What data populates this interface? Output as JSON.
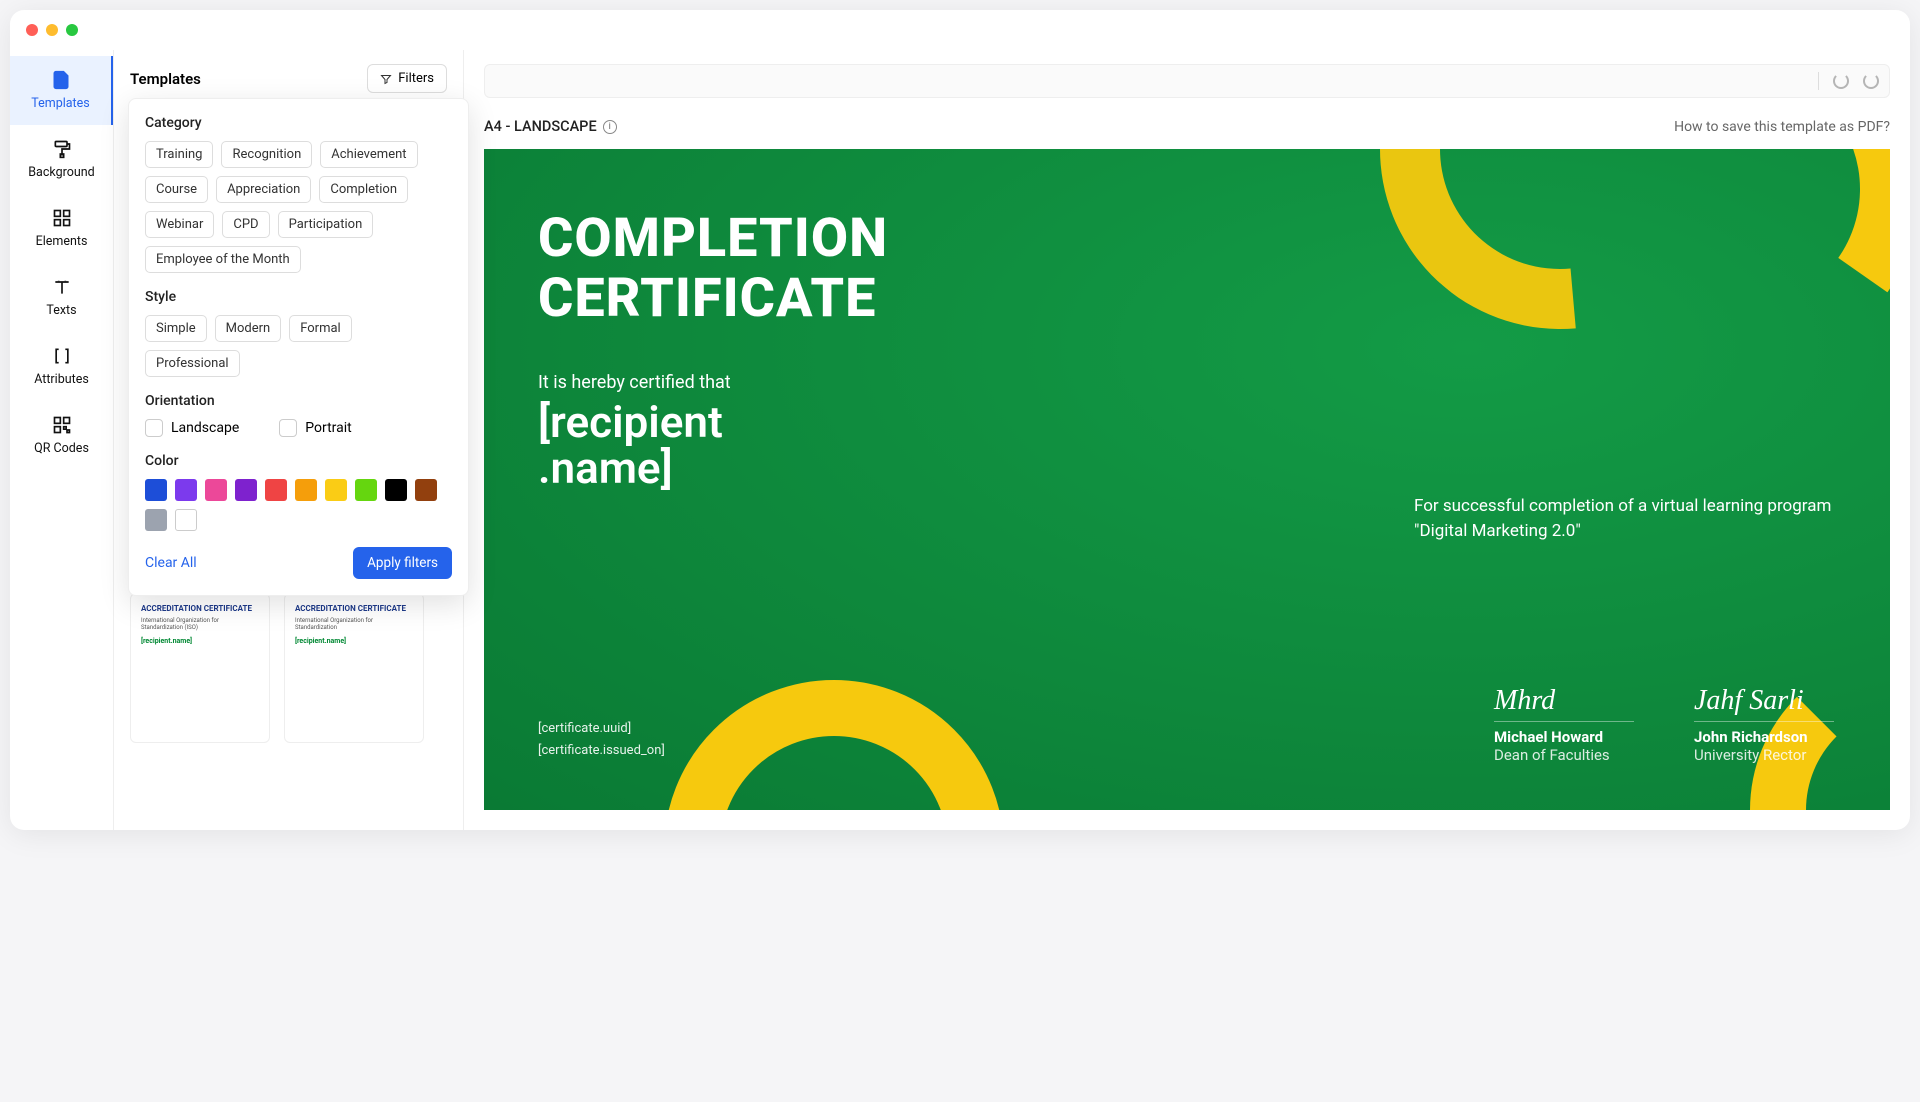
{
  "nav": {
    "items": [
      {
        "label": "Templates"
      },
      {
        "label": "Background"
      },
      {
        "label": "Elements"
      },
      {
        "label": "Texts"
      },
      {
        "label": "Attributes"
      },
      {
        "label": "QR Codes"
      }
    ]
  },
  "panel": {
    "title": "Templates",
    "filters_btn": "Filters"
  },
  "filters": {
    "category_label": "Category",
    "categories": [
      "Training",
      "Recognition",
      "Achievement",
      "Course",
      "Appreciation",
      "Completion",
      "Webinar",
      "CPD",
      "Participation",
      "Employee of the Month"
    ],
    "style_label": "Style",
    "styles": [
      "Simple",
      "Modern",
      "Formal",
      "Professional"
    ],
    "orientation_label": "Orientation",
    "orientation_landscape": "Landscape",
    "orientation_portrait": "Portrait",
    "color_label": "Color",
    "colors": [
      "#1d4ed8",
      "#7c3aed",
      "#ec4899",
      "#7e22ce",
      "#ef4444",
      "#f59e0b",
      "#facc15",
      "#65d60f",
      "#000000",
      "#92400e",
      "#9ca3af",
      "#ffffff"
    ],
    "clear": "Clear All",
    "apply": "Apply filters"
  },
  "thumbs": {
    "t1_title": "ACCREDITATION CERTIFICATE",
    "t1_sub": "International Organization for Standardization (ISO)",
    "t1_name": "[recipient.name]",
    "t2_title": "ACCREDITATION CERTIFICATE",
    "t2_sub": "International Organization for Standardization",
    "t2_name": "[recipient.name]"
  },
  "canvas": {
    "size_label": "A4 - LANDSCAPE",
    "help_link": "How to save this template as PDF?"
  },
  "cert": {
    "title_line1": "COMPLETION",
    "title_line2": "CERTIFICATE",
    "intro": "It is hereby certified that",
    "recipient": "[recipient .name]",
    "desc": "For successful completion of a virtual learning program \"Digital Marketing 2.0\"",
    "uuid": "[certificate.uuid]",
    "issued": "[certificate.issued_on]",
    "sig1_name": "Michael Howard",
    "sig1_role": "Dean of Faculties",
    "sig2_name": "John Richardson",
    "sig2_role": "University Rector"
  }
}
